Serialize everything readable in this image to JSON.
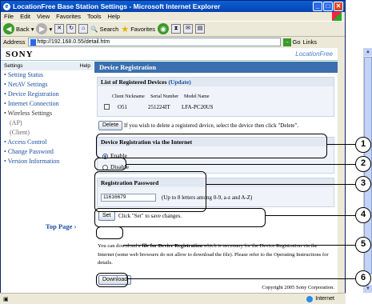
{
  "window": {
    "title": "LocationFree Base Station Settings - Microsoft Internet Explorer",
    "buttons": [
      "_",
      "□",
      "✕"
    ]
  },
  "menu": [
    "File",
    "Edit",
    "View",
    "Favorites",
    "Tools",
    "Help"
  ],
  "toolbar": {
    "back": "Back",
    "search": "Search",
    "favorites": "Favorites"
  },
  "address": {
    "label": "Address",
    "url": "http://192.168.0.55/detail.htm",
    "go": "Go",
    "links": "Links"
  },
  "brand": {
    "sony": "SONY",
    "locationfree": "LocationFree"
  },
  "sidebar": {
    "settings": "Settings",
    "help": "Help",
    "items": [
      "Setting Status",
      "NetAV Settings",
      "Device Registration",
      "Internet Connection",
      "Wireless Settings",
      "(AP)",
      "(Client)",
      "Access Control",
      "Change Password",
      "Version Information"
    ],
    "top_page": "Top Page"
  },
  "main": {
    "title": "Device Registration",
    "list": {
      "heading": "List of Registered Devices",
      "update": "(Update)",
      "columns": [
        "Client Nickname",
        "Serial Number",
        "Model Name"
      ],
      "rows": [
        {
          "nickname": "O51",
          "serial": "251224IT",
          "model": "LFA-PC20US"
        }
      ]
    },
    "delete": {
      "label": "Delete",
      "hint": "If you wish to delete a registered device, select the device then click \"Delete\"."
    },
    "via_internet": {
      "heading": "Device Registration via the Internet",
      "options": [
        "Enable",
        "Disable"
      ],
      "selected": "Enable"
    },
    "password": {
      "heading": "Registration Password",
      "value": "11616679",
      "hint": "(Up to 8 letters among 0-9, a-z and A-Z)"
    },
    "set": {
      "label": "Set",
      "hint": "Click \"Set\" to save changes."
    },
    "info": {
      "pre": "You can download a ",
      "bold": "file for Device Registration",
      "post": " which is necessary for the Device Registration via the Internet (some web browsers do not allow to download the file). Please refer to the Operating Instructions for details."
    },
    "download": "Download",
    "copyright": "Copyright 2005 Sony Corporation."
  },
  "status": {
    "zone": "Internet"
  },
  "callouts": [
    "1",
    "2",
    "3",
    "4",
    "5",
    "6"
  ]
}
